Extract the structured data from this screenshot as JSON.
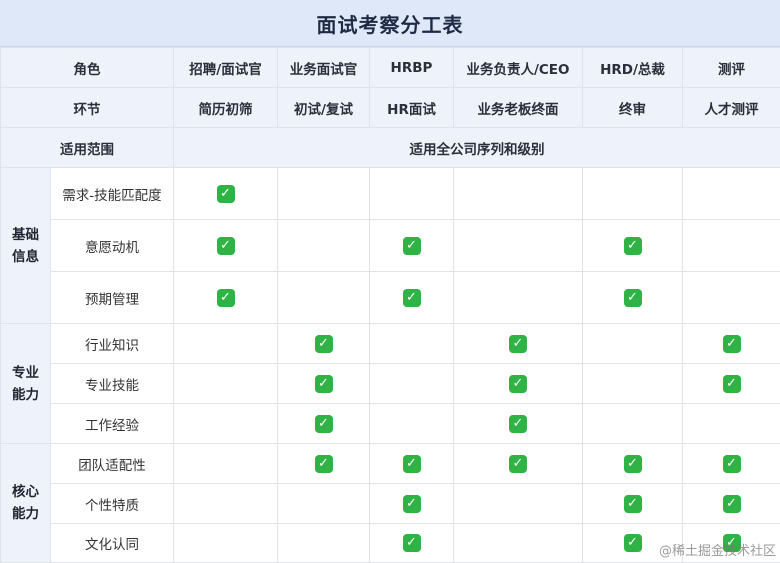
{
  "title": "面试考察分工表",
  "header_rows": [
    {
      "label": "角色",
      "cells": [
        "招聘/面试官",
        "业务面试官",
        "HRBP",
        "业务负责人/CEO",
        "HRD/总裁",
        "测评"
      ]
    },
    {
      "label": "环节",
      "cells": [
        "简历初筛",
        "初试/复试",
        "HR面试",
        "业务老板终面",
        "终审",
        "人才测评"
      ]
    }
  ],
  "scope": {
    "label": "适用范围",
    "value": "适用全公司序列和级别"
  },
  "groups": [
    {
      "name": "基础\n信息",
      "items": [
        {
          "label": "需求-技能匹配度",
          "checks": [
            true,
            false,
            false,
            false,
            false,
            false
          ]
        },
        {
          "label": "意愿动机",
          "checks": [
            true,
            false,
            true,
            false,
            true,
            false
          ]
        },
        {
          "label": "预期管理",
          "checks": [
            true,
            false,
            true,
            false,
            true,
            false
          ]
        }
      ]
    },
    {
      "name": "专业\n能力",
      "items": [
        {
          "label": "行业知识",
          "checks": [
            false,
            true,
            false,
            true,
            false,
            true
          ]
        },
        {
          "label": "专业技能",
          "checks": [
            false,
            true,
            false,
            true,
            false,
            true
          ]
        },
        {
          "label": "工作经验",
          "checks": [
            false,
            true,
            false,
            true,
            false,
            false
          ]
        }
      ]
    },
    {
      "name": "核心\n能力",
      "items": [
        {
          "label": "团队适配性",
          "checks": [
            false,
            true,
            true,
            true,
            true,
            true
          ]
        },
        {
          "label": "个性特质",
          "checks": [
            false,
            false,
            true,
            false,
            true,
            true
          ]
        },
        {
          "label": "文化认同",
          "checks": [
            false,
            false,
            true,
            false,
            true,
            true
          ]
        }
      ]
    }
  ],
  "check_icon": "green-check-mark-icon",
  "check_glyph": "✓",
  "colors": {
    "header_bg": "#eef2fb",
    "title_bg": "#dfe8f8",
    "check_green": "#2fb344"
  },
  "watermark": "@稀土掘金技术社区"
}
